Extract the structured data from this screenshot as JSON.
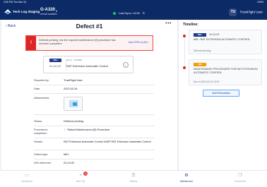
{
  "status_bar": {
    "time": "2:50 PM  Thu Mar 16",
    "battery": "100%"
  },
  "app": {
    "brand": "Tech Log Staging"
  },
  "aircraft": {
    "registration": "G-A320",
    "subtitle": "Aircraft available"
  },
  "sync": {
    "label": "Last Sync: 14:50"
  },
  "user": {
    "initials": "TU",
    "name": "TrustFlight User"
  },
  "defect": {
    "back_label": "Back",
    "title": "Defect #1",
    "alert": {
      "message": "Deferral pending, but the required maintenance (M) procedure has not been completed",
      "link": "Add CRS to (M)"
    },
    "card": {
      "category": "MEL",
      "ata": "24-24-02",
      "subtitle": "ATA C - POWER",
      "description": "RAT Extension Automatic Control"
    },
    "fields": [
      {
        "label": "Reported by:",
        "value": "TrustFlight User"
      },
      {
        "label": "Date:",
        "value": "2023-03-16"
      },
      {
        "label": "Attachments:",
        "value": ""
      },
      {
        "label": "Status:",
        "value": "Deferral pending"
      },
      {
        "label": "Procedures completed:",
        "value": "Raised Maintenance (M) Procedure"
      },
      {
        "label": "Details:",
        "value": "RAT Extension Automatic Control N40P RAT Extension Automatic Control"
      },
      {
        "label": "Defect type:",
        "value": "MEL"
      },
      {
        "label": "ATA reference:",
        "value": "24-24-02"
      }
    ]
  },
  "timeline": {
    "title": "Timeline:",
    "items": [
      {
        "badge": "MEL",
        "badge_color": "#1e3a8a",
        "ata": "24-24-02",
        "description": "MEL: RAT EXTENSION AUTOMATIC CONTROL",
        "status": "Deferral pending"
      },
      {
        "badge": "(M)",
        "badge_color": "#f59e0b",
        "ata": "",
        "description": "MAINTENANCE PROCEDURE FOR RAT EXTENSION AUTOMATIC CONTROL",
        "status": "Due in 2023-03-16 12:00"
      }
    ],
    "add_button": "Add Resolution"
  },
  "tabs": [
    {
      "label": "Dashboard",
      "icon": "dashboard-icon",
      "glyph": "▭"
    },
    {
      "label": "New Trip",
      "icon": "plus-icon",
      "glyph": "+",
      "badge": "1"
    },
    {
      "label": "Defects",
      "icon": "defects-icon",
      "glyph": "☰"
    },
    {
      "label": "Maintenance",
      "icon": "wrench-icon",
      "glyph": "⚙"
    },
    {
      "label": "Documents",
      "icon": "document-icon",
      "glyph": "❐"
    }
  ],
  "colors": {
    "navy": "#0c2a66",
    "alert_red": "#dc2626",
    "accent": "#1e3a8a"
  }
}
